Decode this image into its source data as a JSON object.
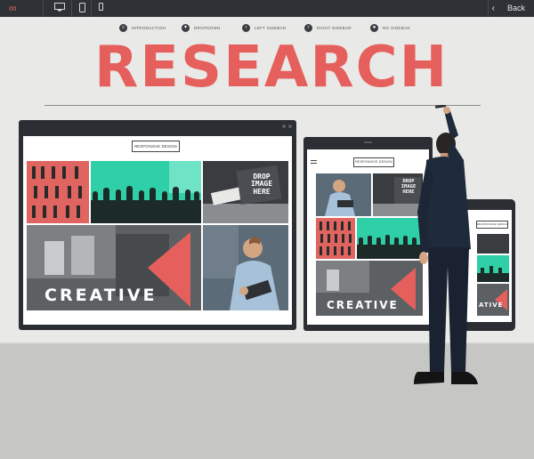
{
  "topbar": {
    "logo_icon": "infinity-icon",
    "devices": [
      "desktop-icon",
      "tablet-icon",
      "phone-icon"
    ],
    "back_label": "Back"
  },
  "nav": [
    {
      "icon": "home-icon",
      "glyph": "⌂",
      "label": "INTRODUCTION"
    },
    {
      "icon": "dropdown-icon",
      "glyph": "▾",
      "label": "DROPDOWN"
    },
    {
      "icon": "arrow-left-icon",
      "glyph": "‹",
      "label": "LEFT SIDEBAR"
    },
    {
      "icon": "arrow-right-icon",
      "glyph": "›",
      "label": "RIGHT SIDEBAR"
    },
    {
      "icon": "person-icon",
      "glyph": "●",
      "label": "NO SIDEBAR"
    }
  ],
  "headline": "RESEARCH",
  "desktop": {
    "button_label": "RESPONSIVE DESIGN",
    "drop_text": "DROP\nIMAGE\nHERE",
    "creative_label": "CREATIVE"
  },
  "tablet": {
    "button_label": "RESPONSIVE DESIGN",
    "drop_text": "DROP\nIMAGE\nHERE",
    "creative_label": "CREATIVE"
  },
  "phone": {
    "button_label": "RESPONSIVE DESIGN",
    "creative_label": "ATIVE"
  },
  "colors": {
    "accent": "#e5605d",
    "teal": "#2fcfa7",
    "frame": "#2b2e33"
  }
}
